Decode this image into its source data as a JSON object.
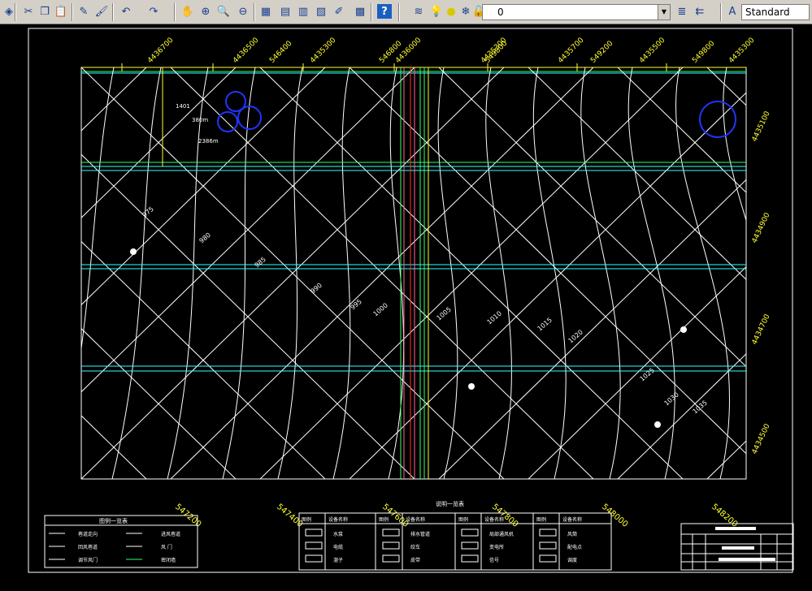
{
  "toolbar": {
    "icons": [
      "layers-icon",
      "cut-icon",
      "copy-icon",
      "paste-icon",
      "brush-icon",
      "match-properties-icon",
      "undo-icon",
      "redo-icon",
      "pan-icon",
      "zoom-realtime-icon",
      "zoom-window-icon",
      "zoom-previous-icon",
      "properties-icon",
      "design-center-icon",
      "tool-palettes-icon",
      "sheet-set-icon",
      "markup-icon",
      "calculator-icon",
      "help-icon",
      "layer-manager-icon",
      "bulb-icon",
      "sun-icon",
      "freeze-icon",
      "lock-icon",
      "color-swatch-icon",
      "layer-states-icon",
      "layer-previous-icon",
      "text-style-icon"
    ],
    "layer_value": "0",
    "text_style_value": "Standard"
  },
  "drawing": {
    "top_coords": [
      "4436700",
      "4436500",
      "546400",
      "4435300",
      "546800",
      "4436000",
      "4435300",
      "549800",
      "4435700",
      "549200",
      "4435500",
      "549800",
      "4435300"
    ],
    "right_coords": [
      "4435100",
      "4434900",
      "4434700",
      "4434500"
    ],
    "bottom_coords": [
      "547200",
      "547400",
      "547600",
      "547800",
      "548000",
      "548200"
    ],
    "contour_labels": [
      "975",
      "980",
      "985",
      "990",
      "995",
      "1000",
      "1005",
      "1010",
      "1015",
      "1020",
      "1025",
      "1030",
      "1035"
    ],
    "notes": [
      "1401",
      "380m",
      "2386m"
    ],
    "bottom_title": "说明一览表",
    "legend_left_title": "图例一览表",
    "legend_left": [
      [
        "巷道走向",
        "进风巷道"
      ],
      [
        "回风巷道",
        "风 门"
      ],
      [
        "调节风门",
        "密闭墙"
      ]
    ],
    "legend_mid_headers": [
      "图例",
      "设备名称",
      "图例",
      "设备名称",
      "图例",
      "设备名称",
      "图例",
      "设备名称"
    ],
    "legend_mid_rows": [
      [
        "水泵",
        "排水管道",
        "局部通风机",
        "风筒"
      ],
      [
        "电缆",
        "绞车",
        "变电所",
        "配电点"
      ],
      [
        "溜子",
        "皮带",
        "信号",
        "调度"
      ]
    ]
  }
}
